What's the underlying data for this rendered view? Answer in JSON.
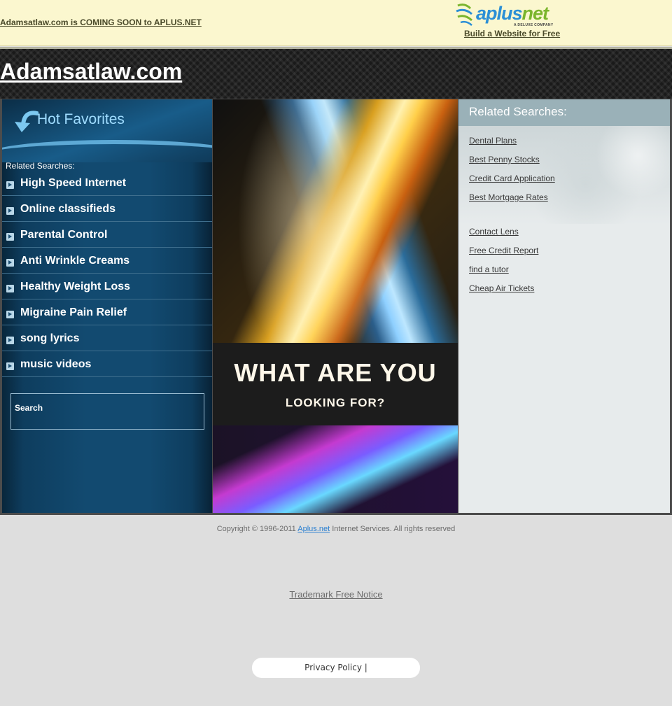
{
  "topbar": {
    "coming_soon": "Adamsatlaw.com is COMING SOON to APLUS.NET",
    "logo_brand_a": "aplus",
    "logo_brand_b": "net",
    "logo_tag": "A DELUXE COMPANY",
    "build_link": "Build a Website for Free"
  },
  "header": {
    "domain": "Adamsatlaw.com"
  },
  "left": {
    "title": "Hot Favorites",
    "related_label": "Related Searches:",
    "items": [
      "High Speed Internet",
      "Online classifieds",
      "Parental Control",
      "Anti Wrinkle Creams",
      "Healthy Weight Loss",
      "Migraine Pain Relief",
      "song lyrics",
      "music videos"
    ],
    "search_label": "Search"
  },
  "center": {
    "headline": "WHAT ARE YOU",
    "subline": "LOOKING FOR?"
  },
  "right": {
    "title": "Related Searches:",
    "group1": [
      "Dental Plans",
      "Best Penny Stocks",
      "Credit Card Application",
      "Best Mortgage Rates"
    ],
    "group2": [
      "Contact Lens",
      "Free Credit Report",
      "find a tutor",
      "Cheap Air Tickets"
    ]
  },
  "footer": {
    "copyright_pre": "Copyright © 1996-2011 ",
    "copyright_link": "Aplus.net",
    "copyright_post": " Internet Services. All rights reserved",
    "trademark": "Trademark Free Notice",
    "privacy": "Privacy Policy |"
  },
  "colors": {
    "topbar_bg": "#fbf7cf",
    "aplus_blue": "#2b8fd6",
    "aplus_green": "#7ab52c",
    "left_panel": "#124a70",
    "right_header": "#9ab1b8",
    "link_blue": "#2a7fd0"
  },
  "icons": {
    "favorites_arrow": "curved-arrow-icon",
    "list_bullet": "chevron-right-icon"
  }
}
